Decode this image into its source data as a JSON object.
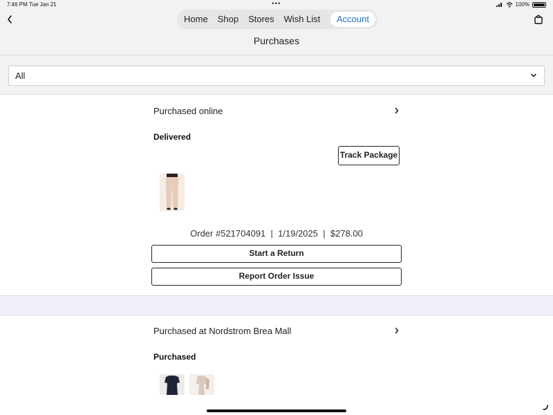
{
  "status_bar": {
    "time": "7:46 PM",
    "date": "Tue Jan 21",
    "battery": "100%",
    "battery_level": 1.0
  },
  "nav": {
    "tabs": [
      {
        "label": "Home"
      },
      {
        "label": "Shop"
      },
      {
        "label": "Stores"
      },
      {
        "label": "Wish List"
      },
      {
        "label": "Account",
        "active": true
      }
    ],
    "accent_color": "#1e72d6"
  },
  "page_title": "Purchases",
  "filter": {
    "selected": "All"
  },
  "orders": [
    {
      "header": "Purchased online",
      "status": "Delivered",
      "track_label": "Track Package",
      "order_number": "Order #521704091",
      "date": "1/19/2025",
      "total": "$278.00",
      "return_label": "Start a Return",
      "issue_label": "Report Order Issue"
    },
    {
      "header": "Purchased at Nordstrom Brea Mall",
      "status": "Purchased"
    }
  ],
  "icons": {
    "back": "chevron-left-icon",
    "bag": "shopping-bag-icon",
    "filter_chevron": "chevron-down-icon",
    "row_chevron": "chevron-right-icon"
  }
}
